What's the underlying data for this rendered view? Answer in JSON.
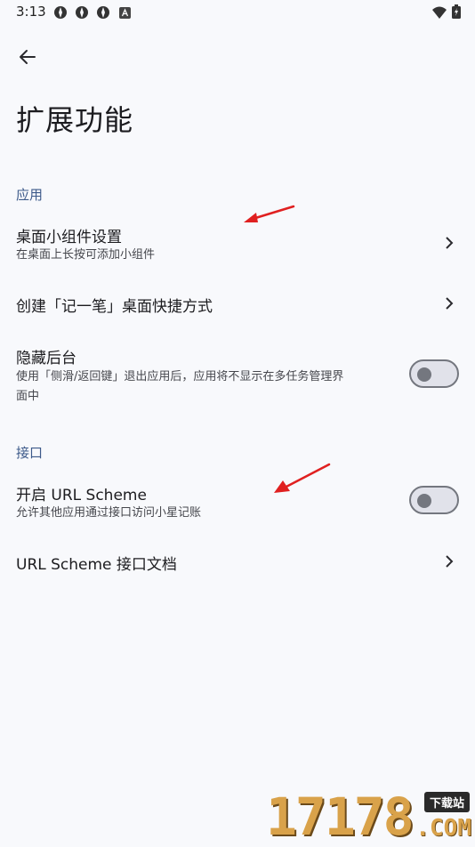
{
  "status_bar": {
    "time": "3:13"
  },
  "page": {
    "title": "扩展功能"
  },
  "sections": {
    "app": "应用",
    "interface": "接口"
  },
  "rows": {
    "widget": {
      "title": "桌面小组件设置",
      "subtitle": "在桌面上长按可添加小组件"
    },
    "shortcut": {
      "title": "创建「记一笔」桌面快捷方式"
    },
    "hide_bg": {
      "title": "隐藏后台",
      "subtitle_line1": "使用「侧滑/返回键」退出应用后，应用将不显示在多任务管理界",
      "subtitle_line2": "面中",
      "enabled": false
    },
    "url_scheme": {
      "title": "开启 URL Scheme",
      "subtitle": "允许其他应用通过接口访问小星记账",
      "enabled": false
    },
    "url_doc": {
      "title": "URL Scheme 接口文档"
    }
  },
  "watermark": {
    "number": "17178",
    "tag": "下载站",
    "domain": ".COM"
  },
  "colors": {
    "background": "#f8f9fc",
    "section": "#3d5a8a",
    "arrow": "#e02020"
  }
}
